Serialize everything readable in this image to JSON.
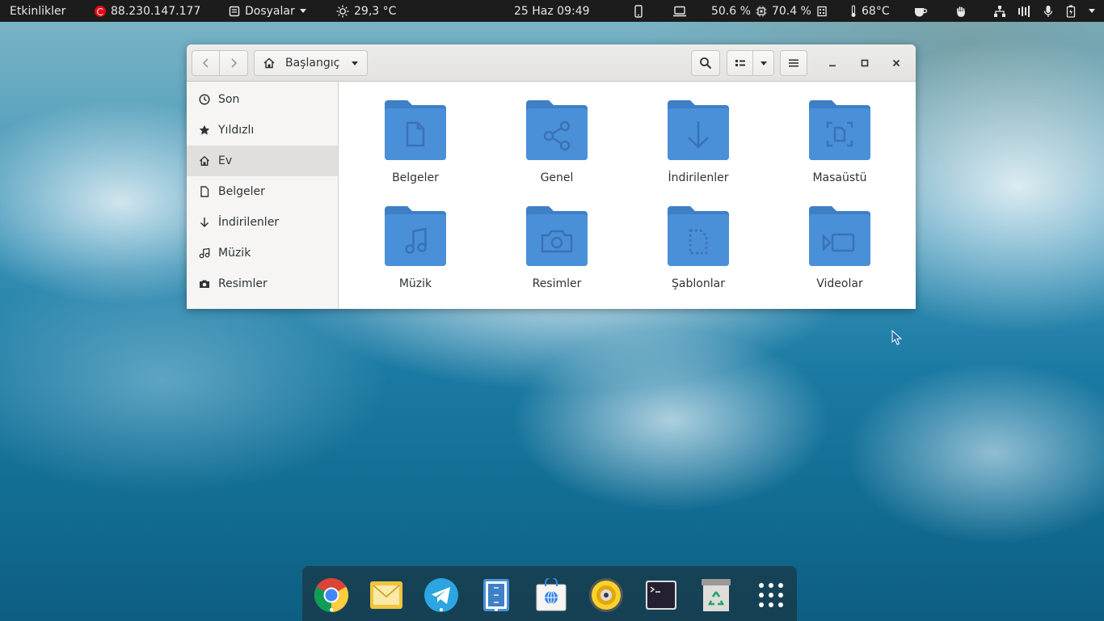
{
  "topbar": {
    "activities": "Etkinlikler",
    "ip": "88.230.147.177",
    "app_menu": "Dosyalar",
    "weather": "29,3 °C",
    "datetime": "25 Haz  09:49",
    "cpu": "50.6 %",
    "memory": "70.4 %",
    "temperature": "68°C"
  },
  "window": {
    "location": "Başlangıç"
  },
  "sidebar": {
    "items": [
      {
        "label": "Son",
        "icon": "clock-icon"
      },
      {
        "label": "Yıldızlı",
        "icon": "star-icon"
      },
      {
        "label": "Ev",
        "icon": "home-icon",
        "active": true
      },
      {
        "label": "Belgeler",
        "icon": "document-icon"
      },
      {
        "label": "İndirilenler",
        "icon": "download-icon"
      },
      {
        "label": "Müzik",
        "icon": "music-icon"
      },
      {
        "label": "Resimler",
        "icon": "camera-icon"
      }
    ]
  },
  "folders": [
    {
      "label": "Belgeler",
      "icon": "document-folder-icon"
    },
    {
      "label": "Genel",
      "icon": "share-folder-icon"
    },
    {
      "label": "İndirilenler",
      "icon": "download-folder-icon"
    },
    {
      "label": "Masaüstü",
      "icon": "desktop-folder-icon"
    },
    {
      "label": "Müzik",
      "icon": "music-folder-icon"
    },
    {
      "label": "Resimler",
      "icon": "pictures-folder-icon"
    },
    {
      "label": "Şablonlar",
      "icon": "templates-folder-icon"
    },
    {
      "label": "Videolar",
      "icon": "videos-folder-icon"
    }
  ],
  "dock": {
    "items": [
      "chrome-icon",
      "mail-icon",
      "telegram-icon",
      "files-icon",
      "software-icon",
      "rhythmbox-icon",
      "terminal-icon",
      "trash-icon",
      "app-grid-icon"
    ]
  },
  "colors": {
    "folder": "#4a90d9",
    "folder_tab": "#3f7fc6",
    "topbar": "#1c1c1c"
  }
}
